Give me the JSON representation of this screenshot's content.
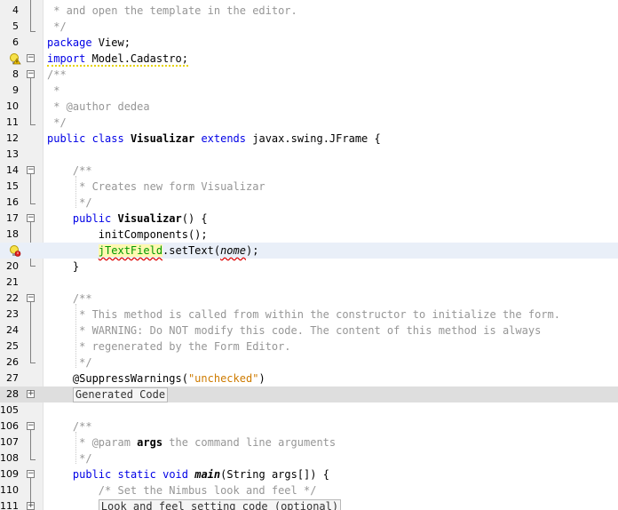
{
  "editor": {
    "lines": [
      {
        "n": "4",
        "t": " * and open the template in the editor."
      },
      {
        "n": "5",
        "t": " */"
      },
      {
        "n": "6",
        "t": "package View;"
      },
      {
        "n": "7",
        "t": "import Model.Cadastro;"
      },
      {
        "n": "8",
        "t": "/**"
      },
      {
        "n": "9",
        "t": " *"
      },
      {
        "n": "10",
        "t": " * @author dedea"
      },
      {
        "n": "11",
        "t": " */"
      },
      {
        "n": "12",
        "t": "public class Visualizar extends javax.swing.JFrame {"
      },
      {
        "n": "13",
        "t": ""
      },
      {
        "n": "14",
        "t": "    /**"
      },
      {
        "n": "15",
        "t": "     * Creates new form Visualizar"
      },
      {
        "n": "16",
        "t": "     */"
      },
      {
        "n": "17",
        "t": "    public Visualizar() {"
      },
      {
        "n": "18",
        "t": "        initComponents();"
      },
      {
        "n": "19",
        "t": "        jTextField.setText(nome);"
      },
      {
        "n": "20",
        "t": "    }"
      },
      {
        "n": "21",
        "t": ""
      },
      {
        "n": "22",
        "t": "    /**"
      },
      {
        "n": "23",
        "t": "     * This method is called from within the constructor to initialize the form."
      },
      {
        "n": "24",
        "t": "     * WARNING: Do NOT modify this code. The content of this method is always"
      },
      {
        "n": "25",
        "t": "     * regenerated by the Form Editor."
      },
      {
        "n": "26",
        "t": "     */"
      },
      {
        "n": "27",
        "t": "    @SuppressWarnings(\"unchecked\")"
      },
      {
        "n": "28",
        "t": "Generated Code"
      },
      {
        "n": "105",
        "t": ""
      },
      {
        "n": "106",
        "t": "    /**"
      },
      {
        "n": "107",
        "t": "     * @param args the command line arguments"
      },
      {
        "n": "108",
        "t": "     */"
      },
      {
        "n": "109",
        "t": "    public static void main(String args[]) {"
      },
      {
        "n": "110",
        "t": "        /* Set the Nimbus look and feel */"
      },
      {
        "n": "111",
        "t": "Look and feel setting code (optional)"
      }
    ]
  },
  "colors": {
    "keyword": "#0000e6",
    "comment": "#969696",
    "string": "#ce7b00",
    "field": "#009900",
    "current_line": "#e9eff8"
  },
  "icons": {
    "line7": "warning-bulb-icon",
    "line19": "error-bulb-icon"
  }
}
